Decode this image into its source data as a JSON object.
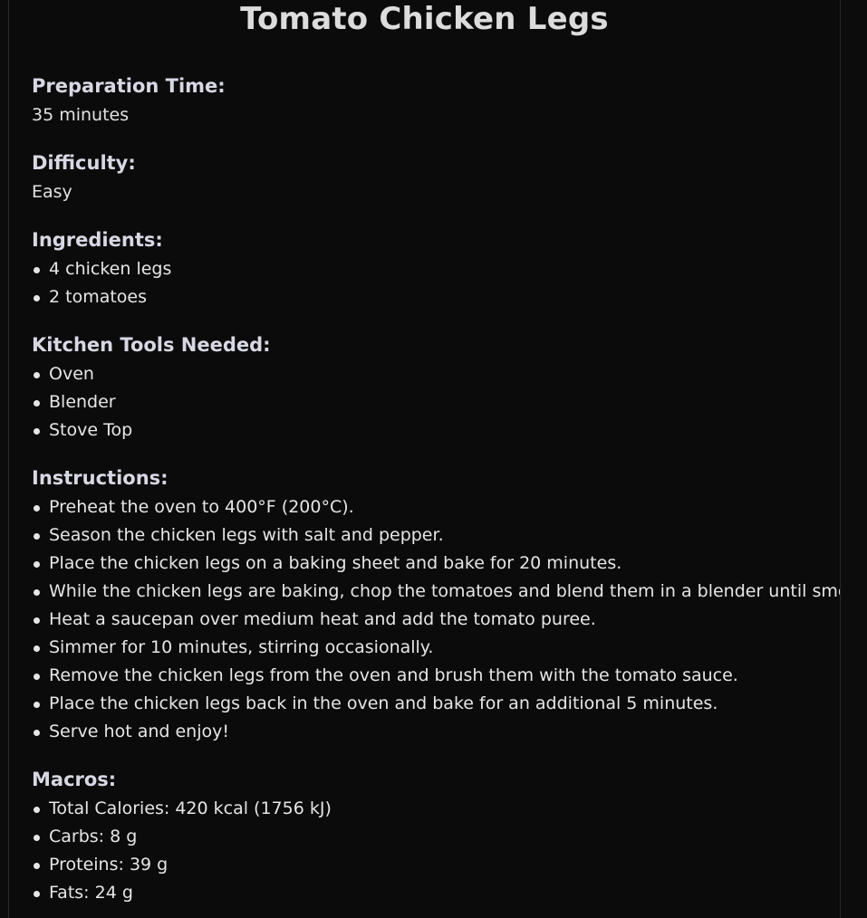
{
  "recipe": {
    "title": "Tomato Chicken Legs",
    "prep_time": {
      "label": "Preparation Time:",
      "value": "35 minutes"
    },
    "difficulty": {
      "label": "Difficulty:",
      "value": "Easy"
    },
    "ingredients": {
      "label": "Ingredients:",
      "items": [
        "4 chicken legs",
        "2 tomatoes"
      ]
    },
    "tools": {
      "label": "Kitchen Tools Needed:",
      "items": [
        "Oven",
        "Blender",
        "Stove Top"
      ]
    },
    "instructions": {
      "label": "Instructions:",
      "items": [
        "Preheat the oven to 400°F (200°C).",
        "Season the chicken legs with salt and pepper.",
        "Place the chicken legs on a baking sheet and bake for 20 minutes.",
        "While the chicken legs are baking, chop the tomatoes and blend them in a blender until smooth.",
        "Heat a saucepan over medium heat and add the tomato puree.",
        "Simmer for 10 minutes, stirring occasionally.",
        "Remove the chicken legs from the oven and brush them with the tomato sauce.",
        "Place the chicken legs back in the oven and bake for an additional 5 minutes.",
        "Serve hot and enjoy!"
      ]
    },
    "macros": {
      "label": "Macros:",
      "items": [
        "Total Calories: 420 kcal (1756 kJ)",
        "Carbs: 8 g",
        "Proteins: 39 g",
        "Fats: 24 g"
      ]
    }
  }
}
